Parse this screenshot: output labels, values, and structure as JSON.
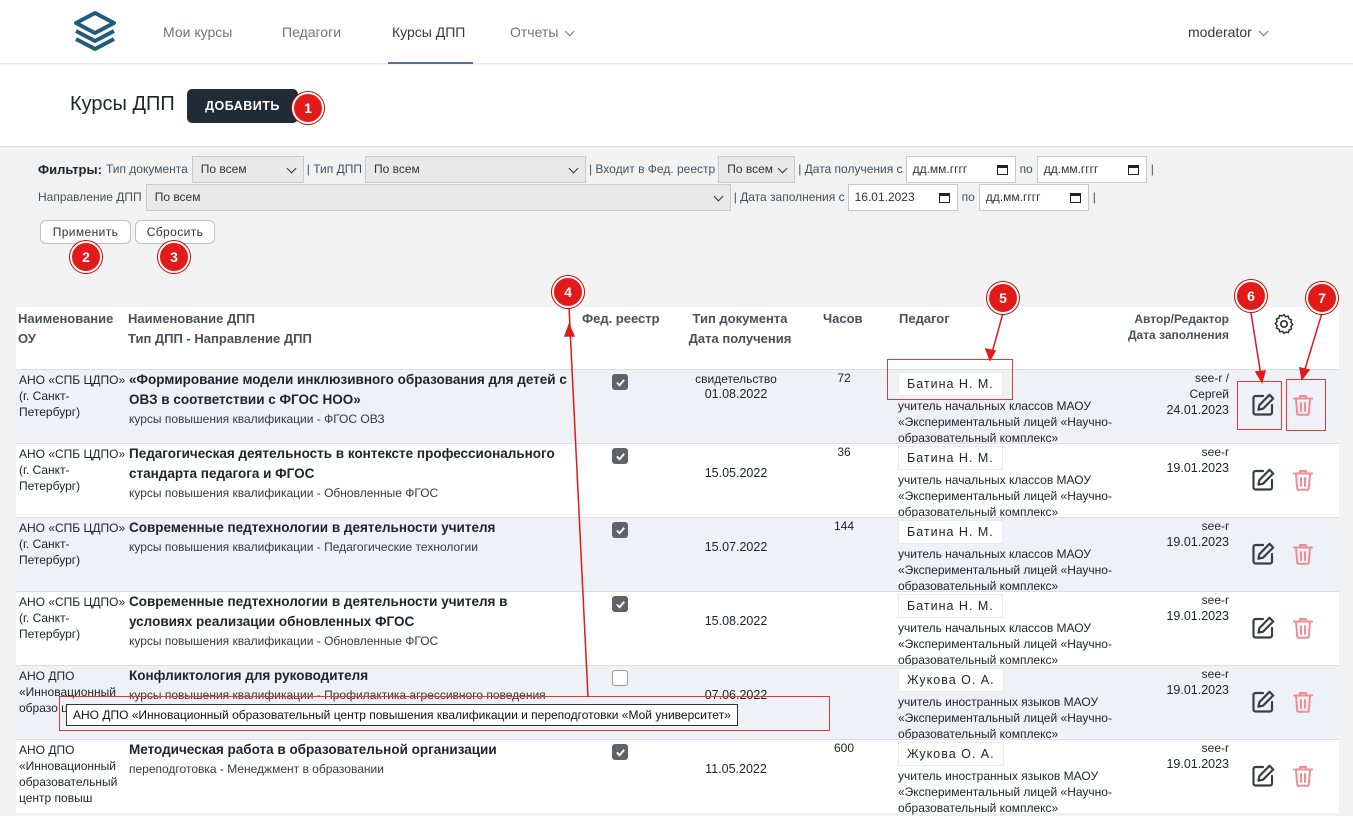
{
  "nav": {
    "items": [
      "Мои курсы",
      "Педагоги",
      "Курсы ДПП",
      "Отчеты"
    ],
    "user": "moderator"
  },
  "header": {
    "title": "Курсы ДПП",
    "add_label": "ДОБАВИТЬ"
  },
  "filters": {
    "label": "Фильтры:",
    "doc_type_label": "Тип документа",
    "doc_type_value": "По всем",
    "dpp_type_label": "| Тип ДПП",
    "dpp_type_value": "По всем",
    "fed_label": "| Входит в Фед. реестр",
    "fed_value": "По всем",
    "received_label": "| Дата получения с",
    "date_placeholder": "дд.мм.гггг",
    "to_label": "по",
    "sep": "|",
    "direction_label": "Направление ДПП",
    "direction_value": "По всем",
    "filled_label": "| Дата заполнения с",
    "filled_from": "16.01.2023",
    "apply": "Применить",
    "reset": "Сбросить"
  },
  "table": {
    "headers": {
      "ou": "Наименование ОУ",
      "dpp": "Наименование ДПП",
      "dpp2": "Тип ДПП - Направление ДПП",
      "fed": "Фед. реестр",
      "doc": "Тип документа Дата получения",
      "hours": "Часов",
      "teacher": "Педагог",
      "author": "Автор/Редактор",
      "author2": "Дата заполнения"
    },
    "rows": [
      {
        "ou": "АНО «СПБ ЦДПО» (г. Санкт-Петербург)",
        "name": "«Формирование модели инклюзивного образования для детей с ОВЗ в соответствии с ФГОС НОО»",
        "sub": "курсы повышения квалификации - ФГОС ОВЗ",
        "fed": true,
        "doc": "свидетельство",
        "date": "01.08.2022",
        "hours": "72",
        "teacher": "Батина Н. М.",
        "position": "учитель начальных классов МАОУ «Экспериментальный лицей «Научно-образовательный комплекс»",
        "author": "see-r /",
        "author2": "Сергей",
        "filled": "24.01.2023"
      },
      {
        "ou": "АНО «СПБ ЦДПО» (г. Санкт-Петербург)",
        "name": "Педагогическая деятельность в контексте профессионального стандарта педагога и ФГОС",
        "sub": "курсы повышения квалификации - Обновленные ФГОС",
        "fed": true,
        "doc": "",
        "date": "15.05.2022",
        "hours": "36",
        "teacher": "Батина Н. М.",
        "position": "учитель начальных классов МАОУ «Экспериментальный лицей «Научно-образовательный комплекс»",
        "author": "see-r",
        "author2": "",
        "filled": "19.01.2023"
      },
      {
        "ou": "АНО «СПБ ЦДПО» (г. Санкт-Петербург)",
        "name": "Современные педтехнологии в деятельности учителя",
        "sub": "курсы повышения квалификации - Педагогические технологии",
        "fed": true,
        "doc": "",
        "date": "15.07.2022",
        "hours": "144",
        "teacher": "Батина Н. М.",
        "position": "учитель начальных классов МАОУ «Экспериментальный лицей «Научно-образовательный комплекс»",
        "author": "see-r",
        "author2": "",
        "filled": "19.01.2023"
      },
      {
        "ou": "АНО «СПБ ЦДПО» (г. Санкт-Петербург)",
        "name": "Современные педтехнологии в деятельности учителя в условиях реализации обновленных ФГОС",
        "sub": "курсы повышения квалификации - Обновленные ФГОС",
        "fed": true,
        "doc": "",
        "date": "15.08.2022",
        "hours": "",
        "teacher": "Батина Н. М.",
        "position": "учитель начальных классов МАОУ «Экспериментальный лицей «Научно-образовательный комплекс»",
        "author": "see-r",
        "author2": "",
        "filled": "19.01.2023"
      },
      {
        "ou": "АНО ДПО «Инновационный образо центр п",
        "name": "Конфликтология для руководителя",
        "sub": "курсы повышения квалификации - Профилактика агрессивного поведения",
        "fed": false,
        "doc": "",
        "date": "07.06.2022",
        "hours": "",
        "teacher": "Жукова О. А.",
        "position": "учитель иностранных языков МАОУ «Экспериментальный лицей «Научно-образовательный комплекс»",
        "author": "see-r",
        "author2": "",
        "filled": "19.01.2023"
      },
      {
        "ou": "АНО ДПО «Инновационный образовательный центр повыш",
        "name": "Методическая работа в образовательной организации",
        "sub": "переподготовка - Менеджмент в образовании",
        "fed": true,
        "doc": "",
        "date": "11.05.2022",
        "hours": "600",
        "teacher": "Жукова О. А.",
        "position": "учитель иностранных языков МАОУ «Экспериментальный лицей «Научно-образовательный комплекс»",
        "author": "see-r",
        "author2": "",
        "filled": "19.01.2023"
      }
    ]
  },
  "tooltip": "АНО ДПО «Инновационный образовательный центр повышения квалификации и переподготовки «Мой университет»",
  "markers": [
    "1",
    "2",
    "3",
    "4",
    "5",
    "6",
    "7"
  ],
  "colors": {
    "accent_dark": "#212b36",
    "annotation_red": "#e21a1a",
    "delete_pink": "#f28b94",
    "row_alt": "#eef1f5"
  }
}
